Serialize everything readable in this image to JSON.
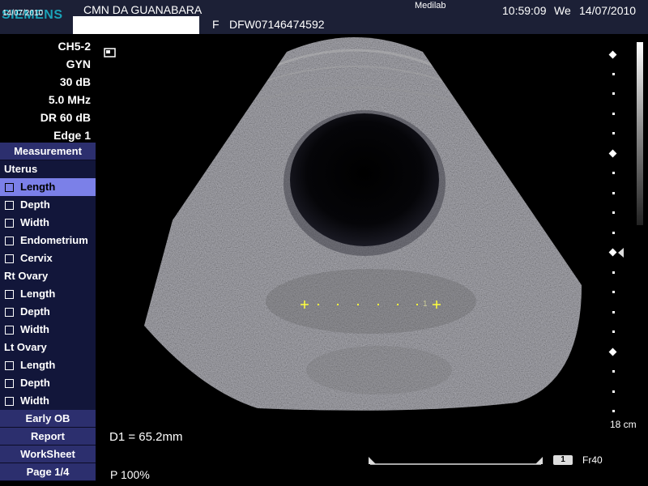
{
  "header": {
    "logo": "SIEMENS",
    "logo_date": "14/07/2010",
    "hospital": "CMN DA GUANABARA",
    "sex": "F",
    "patient_id": "DFW07146474592",
    "institution": "Medilab",
    "time": "10:59:09",
    "weekday": "We",
    "date": "14/07/2010"
  },
  "params": [
    "CH5-2",
    "GYN",
    "30 dB",
    "5.0 MHz",
    "DR 60 dB",
    "Edge 1"
  ],
  "menu": {
    "header": "Measurement",
    "groups": [
      {
        "title": "Uterus",
        "items": [
          "Length",
          "Depth",
          "Width",
          "Endometrium",
          "Cervix"
        ]
      },
      {
        "title": "Rt Ovary",
        "items": [
          "Length",
          "Depth",
          "Width"
        ]
      },
      {
        "title": "Lt Ovary",
        "items": [
          "Length",
          "Depth",
          "Width"
        ]
      }
    ],
    "selected_item": "Uterus / Length",
    "buttons": [
      "Early OB",
      "Report",
      "WorkSheet",
      "Page 1/4"
    ]
  },
  "image": {
    "caliper_label": "1"
  },
  "scale": {
    "depth": "18 cm"
  },
  "footer": {
    "measurement": "D1 = 65.2mm",
    "power": "P 100%",
    "cine_index": "1",
    "frame": "Fr40"
  },
  "colors": {
    "header_bg": "#1c2036",
    "menu_bg": "#12163a",
    "menu_button_bg": "#2c2f6e",
    "selected_bg": "#7b80e8",
    "logo": "#1aa3b8",
    "caliper": "#ffff3c"
  }
}
